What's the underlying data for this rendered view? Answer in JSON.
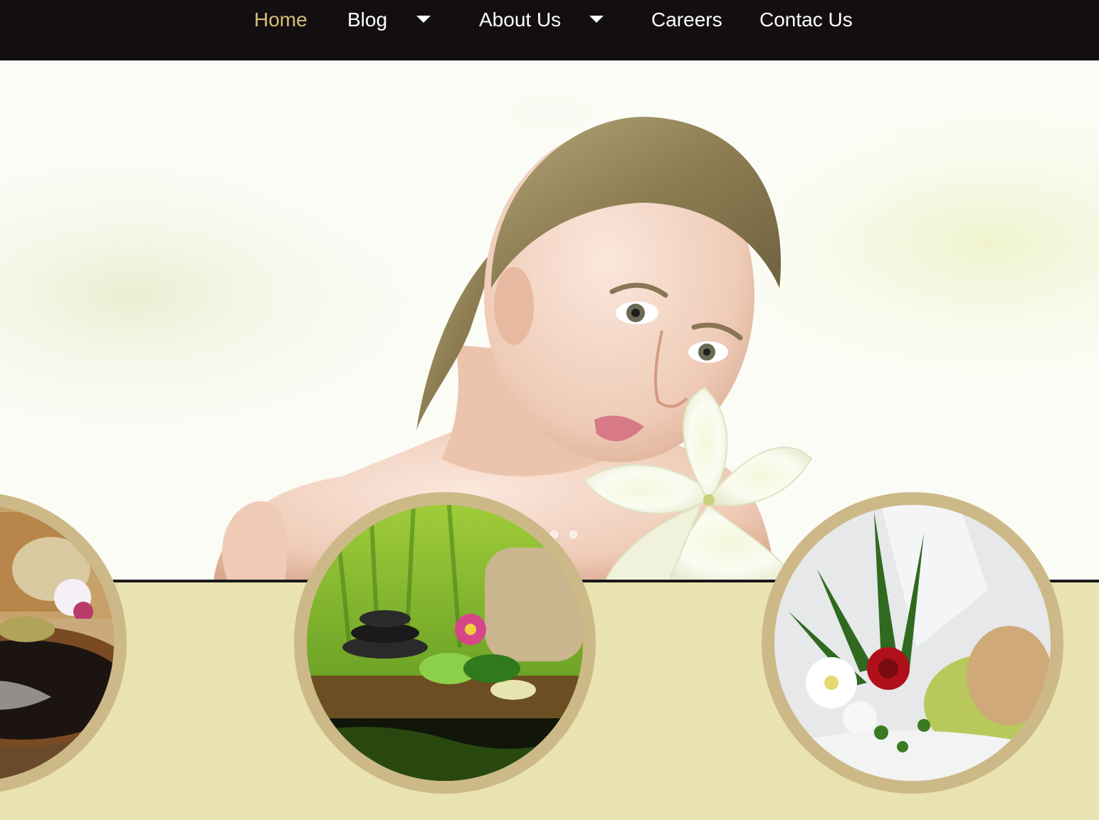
{
  "nav": {
    "items": [
      {
        "label": "Home",
        "active": true,
        "dropdown": false
      },
      {
        "label": "Blog",
        "active": false,
        "dropdown": true
      },
      {
        "label": "About Us",
        "active": false,
        "dropdown": true
      },
      {
        "label": "Careers",
        "active": false,
        "dropdown": false
      },
      {
        "label": "Contac Us",
        "active": false,
        "dropdown": false
      }
    ],
    "dropdown_icon": "caret-down-icon"
  },
  "hero": {
    "image": "woman-with-lily-photo",
    "slider_dots": 2
  },
  "circles": [
    {
      "image": "bowl-and-orchid-photo"
    },
    {
      "image": "spa-stones-towel-photo"
    },
    {
      "image": "fern-rose-cream-jar-photo"
    }
  ],
  "colors": {
    "nav_bg": "#130f11",
    "active_link": "#d8bf74",
    "link": "#ffffff",
    "cream_band": "#e8e3b1",
    "circle_ring": "#cdb987",
    "separator": "#1b1919"
  }
}
